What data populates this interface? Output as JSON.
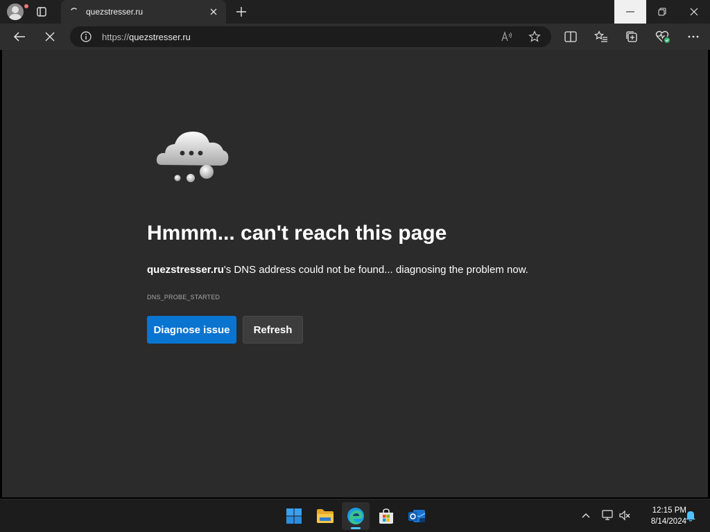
{
  "window": {
    "tab_title": "quezstresser.ru"
  },
  "address_bar": {
    "url_scheme": "https://",
    "url_host": "quezstresser.ru"
  },
  "error_page": {
    "headline": "Hmmm... can't reach this page",
    "host_bold": "quezstresser.ru",
    "message_rest": "'s DNS address could not be found... diagnosing the problem now.",
    "error_code": "DNS_PROBE_STARTED",
    "diagnose_label": "Diagnose issue",
    "refresh_label": "Refresh"
  },
  "taskbar": {
    "apps": [
      "windows-start-icon",
      "file-explorer-icon",
      "edge-browser-icon",
      "microsoft-store-icon",
      "outlook-icon"
    ],
    "active_app": "edge-browser-icon",
    "time": "12:15 PM",
    "date": "8/14/2024"
  },
  "colors": {
    "accent": "#0a74d1",
    "page_bg": "#2b2b2b",
    "chrome_bg": "#202020"
  }
}
